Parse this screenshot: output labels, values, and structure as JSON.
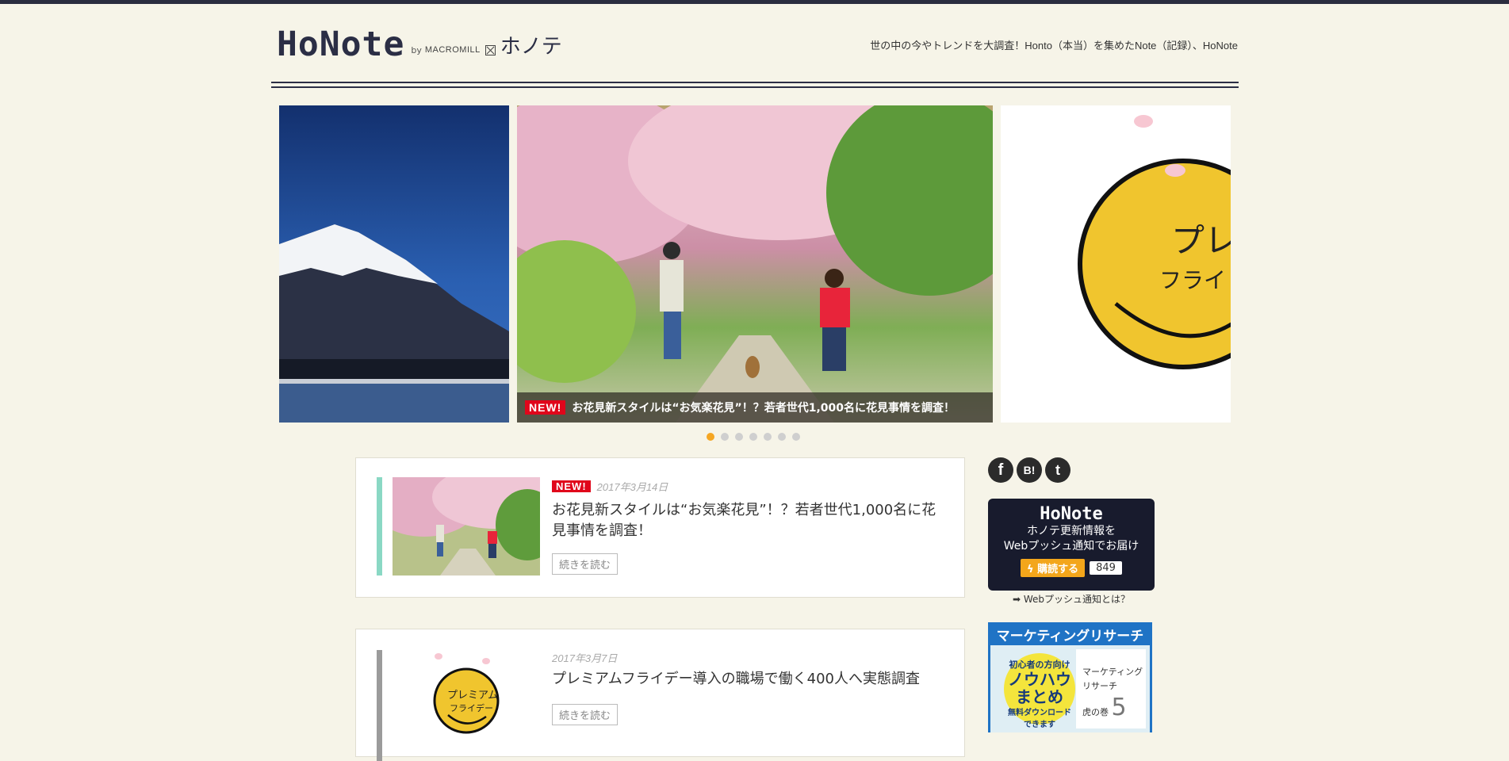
{
  "header": {
    "logo": "HoNote",
    "logo_by": "by",
    "logo_company": "MACROMILL",
    "logo_kana": "ホノテ",
    "tagline": "世の中の今やトレンドを大調査！Honto（本当）を集めたNote（記録）、HoNote"
  },
  "slider": {
    "new_badge": "NEW!",
    "caption": "お花見新スタイルは“お気楽花見”！？若者世代1,000名に花見事情を調査！",
    "right_logo_text_1": "プレミ",
    "right_logo_text_2": "フライ",
    "dots_count": 7,
    "active_dot": 0
  },
  "articles": [
    {
      "new_badge": "NEW!",
      "date": "2017年3月14日",
      "title": "お花見新スタイルは“お気楽花見”！？若者世代1,000名に花見事情を調査！",
      "read_more": "続きを読む"
    },
    {
      "date": "2017年3月7日",
      "title": "プレミアムフライデー導入の職場で働く400人へ実態調査",
      "thumb_text_1": "プレミアム",
      "thumb_text_2": "フライデー",
      "read_more": "続きを読む"
    }
  ],
  "sidebar": {
    "social": {
      "facebook": "f",
      "hatena": "B!",
      "twitter": "t"
    },
    "push": {
      "logo": "HoNote",
      "line1": "ホノテ更新情報を",
      "line2": "Webプッシュ通知でお届け",
      "subscribe": "購読する",
      "count": "849",
      "link": "➡ Webプッシュ通知とは？"
    },
    "banner": {
      "heading": "マーケティングリサーチ",
      "circle_1": "初心者の方向け",
      "circle_2a": "ノウハウ",
      "circle_2b": "まとめ",
      "circle_3": "無料ダウンロード",
      "circle_4": "できます",
      "book_1": "マーケティング",
      "book_2": "リサーチ",
      "book_3": "虎の巻",
      "book_num": "5"
    }
  },
  "colors": {
    "background": "#f6f4e8",
    "navy": "#2b2e45",
    "new_red": "#e0061b",
    "accent_orange": "#f5a623",
    "teal_accent": "#8ad8c4"
  }
}
